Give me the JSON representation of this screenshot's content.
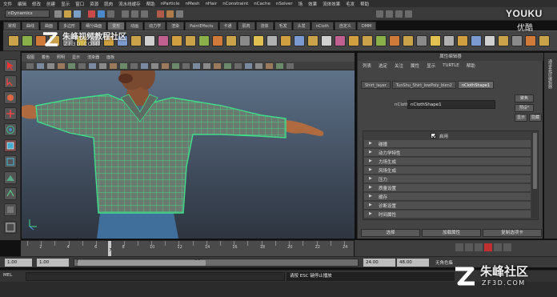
{
  "menubar": [
    "文件",
    "编辑",
    "修改",
    "创建",
    "显示",
    "窗口",
    "资源",
    "肌肉",
    "流水线缓存",
    "帮助",
    "nParticle",
    "nMesh",
    "nHair",
    "nConstraint",
    "nCache",
    "nSolver",
    "场",
    "效果",
    "流体效果",
    "毛发",
    "帮助"
  ],
  "menu_mode": "nDynamics",
  "shelf_tabs": [
    "常规",
    "曲线",
    "曲面",
    "多边形",
    "细分曲面",
    "变形",
    "动画",
    "动力学",
    "渲染",
    "PaintEffects",
    "卡通",
    "肌肉",
    "流体",
    "毛发",
    "头发",
    "nCloth",
    "自定义",
    "DMM"
  ],
  "shelf_active_index": 5,
  "viewport_menu": [
    "视图",
    "着色",
    "照明",
    "显示",
    "渲染器",
    "面板"
  ],
  "attr_editor": {
    "title": "属性编辑器",
    "menu": [
      "列表",
      "选定",
      "关注",
      "属性",
      "显示",
      "TURTLE",
      "帮助"
    ],
    "tabs": [
      "Shirt_layer",
      "TunShu_Shirt_lowPoly_blen2",
      "nClothShape1"
    ],
    "active_tab": 2,
    "ncloth_label": "nCloth:",
    "ncloth_value": "nClothShape1",
    "btn_focus": "聚焦",
    "btn_presets": "预设*",
    "btn_show": "显示",
    "btn_hide": "隐藏",
    "enable_label": "启用",
    "enable_checked": true,
    "sections": [
      "碰撞",
      "动力学特性",
      "力场生成",
      "风场生成",
      "压力",
      "质量设置",
      "缓存",
      "诊断设置",
      "时间属性"
    ],
    "bottom_buttons": [
      "选择",
      "加载属性",
      "复制选项卡"
    ]
  },
  "right_strip_label": "通道盒/层编辑器",
  "timeline": {
    "ticks": [
      "2",
      "4",
      "6",
      "8",
      "10",
      "12",
      "14",
      "16",
      "18",
      "20",
      "22",
      "24"
    ],
    "current_frame": "7",
    "current_frame_value": 7
  },
  "range": {
    "start": "1.00",
    "playback_start": "1.00",
    "range_in": "1",
    "range_out": "24",
    "playback_end": "24.00",
    "end": "48.00",
    "char_set": "无角色集"
  },
  "cmdline": {
    "label": "MEL",
    "result": "请按 ESC 键停止播放"
  },
  "watermarks": {
    "logo_cn": "朱峰视频教程社区",
    "logo_url": "ZF3D.COM",
    "youku": "YOUKU",
    "youku_cn": "优酷",
    "corner_cn": "朱峰社区",
    "corner_url": "ZF3D.COM"
  },
  "colors": {
    "mesh_wire": "#3fe08a",
    "shirt": "#6a7a6e",
    "skin": "#b06a40",
    "jeans": "#3f6f9a",
    "viewport_top": "#5e7289"
  }
}
